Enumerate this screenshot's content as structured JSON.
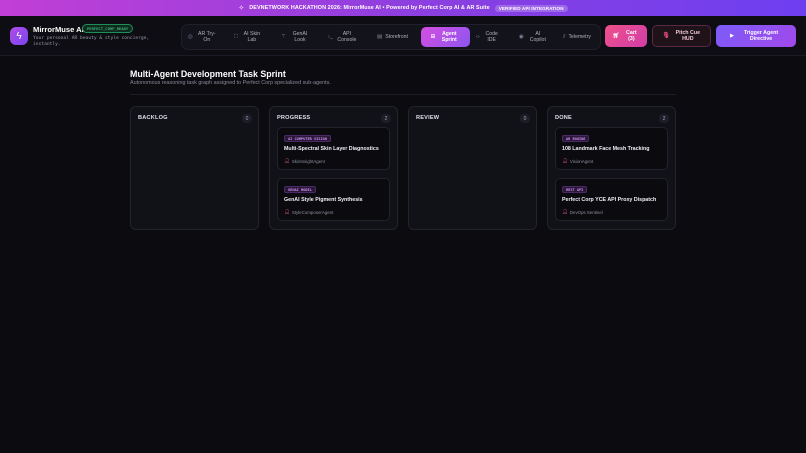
{
  "banner": {
    "text": "DEVNETWORK HACKATHON 2026: MirrorMuse AI • Powered by Perfect Corp AI & AR Suite",
    "badge": "VERIFIED API INTEGRATION"
  },
  "brand": {
    "name": "MirrorMuse AI",
    "status": "PERFECT_CORP_READY",
    "tagline": "Your personal AR beauty & style concierge, instantly."
  },
  "nav": {
    "items": [
      {
        "label": "AR Try-On",
        "icon": "camera-icon"
      },
      {
        "label": "AI Skin Lab",
        "icon": "scan-icon"
      },
      {
        "label": "GenAI Look",
        "icon": "wand-icon"
      },
      {
        "label": "API Console",
        "icon": "terminal-icon"
      },
      {
        "label": "Storefront",
        "icon": "store-icon"
      },
      {
        "label": "Agent Sprint",
        "icon": "grid-icon",
        "active": true
      },
      {
        "label": "Code IDE",
        "icon": "code-icon"
      },
      {
        "label": "AI Copilot",
        "icon": "bot-icon"
      },
      {
        "label": "Telemetry",
        "icon": "chart-icon"
      }
    ]
  },
  "actions": {
    "cart": "Cart (3)",
    "pitch": "Pitch Cue HUD",
    "trigger": "Trigger Agent Directive"
  },
  "main": {
    "title": "Multi-Agent Development Task Sprint",
    "subtitle": "Autonomous reasoning task graph assigned to Perfect Corp specialized sub-agents."
  },
  "columns": [
    {
      "title": "BACKLOG",
      "count": "0",
      "cards": []
    },
    {
      "title": "PROGRESS",
      "count": "2",
      "cards": [
        {
          "tag": "AI COMPUTER VISION",
          "title": "Multi-Spectral Skin Layer Diagnostics",
          "agent": "SkinInsightAgent"
        },
        {
          "tag": "GENAI MODEL",
          "title": "GenAI Style Pigment Synthesis",
          "agent": "StyleComposerAgent"
        }
      ]
    },
    {
      "title": "REVIEW",
      "count": "0",
      "cards": []
    },
    {
      "title": "DONE",
      "count": "2",
      "cards": [
        {
          "tag": "AR ENGINE",
          "title": "108 Landmark Face Mesh Tracking",
          "agent": "VisionAgent"
        },
        {
          "tag": "REST API",
          "title": "Perfect Corp YCE API Proxy Dispatch",
          "agent": "DevOps Sentinel"
        }
      ]
    }
  ],
  "colors": {
    "accent": "#d54ee0",
    "accent2": "#7c5cf8",
    "cart": "#f0508a",
    "ready": "#4fe09a"
  }
}
